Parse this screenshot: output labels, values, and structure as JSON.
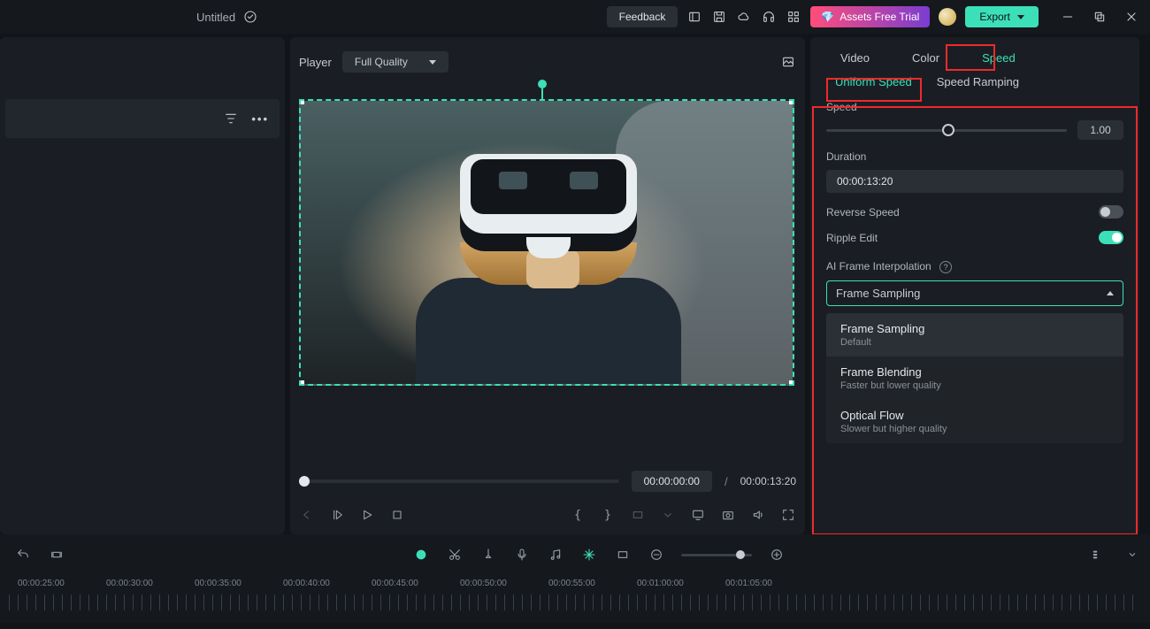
{
  "titlebar": {
    "doc_title": "Untitled",
    "feedback": "Feedback",
    "assets_trial": "Assets Free Trial",
    "export": "Export"
  },
  "player": {
    "label": "Player",
    "quality": "Full Quality",
    "current_time": "00:00:00:00",
    "separator": "/",
    "duration": "00:00:13:20",
    "brace_open": "{",
    "brace_close": "}"
  },
  "inspector": {
    "tabs": {
      "video": "Video",
      "color": "Color",
      "speed": "Speed"
    },
    "subtabs": {
      "uniform": "Uniform Speed",
      "ramping": "Speed Ramping"
    },
    "speed_label": "Speed",
    "speed_value": "1.00",
    "duration_label": "Duration",
    "duration_value": "00:00:13:20",
    "reverse_label": "Reverse Speed",
    "ripple_label": "Ripple Edit",
    "ai_label": "AI Frame Interpolation",
    "ai_selected": "Frame Sampling",
    "options": [
      {
        "title": "Frame Sampling",
        "sub": "Default"
      },
      {
        "title": "Frame Blending",
        "sub": "Faster but lower quality"
      },
      {
        "title": "Optical Flow",
        "sub": "Slower but higher quality"
      }
    ]
  },
  "timeline": {
    "labels": [
      "00:00:25:00",
      "00:00:30:00",
      "00:00:35:00",
      "00:00:40:00",
      "00:00:45:00",
      "00:00:50:00",
      "00:00:55:00",
      "00:01:00:00",
      "00:01:05:00"
    ]
  }
}
